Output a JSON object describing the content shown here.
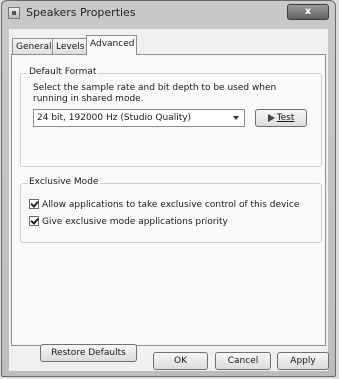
{
  "window": {
    "title": "Speakers Properties",
    "close_label": "x"
  },
  "tabs": [
    {
      "label": "General"
    },
    {
      "label": "Levels"
    },
    {
      "label": "Advanced"
    }
  ],
  "default_format": {
    "label": "Default Format",
    "description": "Select the sample rate and bit depth to be used when running in shared mode.",
    "selected": "24 bit, 192000 Hz (Studio Quality)",
    "test_label": "Test"
  },
  "exclusive_mode": {
    "label": "Exclusive Mode",
    "options": [
      {
        "label": "Allow applications to take exclusive control of this device",
        "checked": true
      },
      {
        "label": "Give exclusive mode applications priority",
        "checked": true
      }
    ]
  },
  "buttons": {
    "restore": "Restore Defaults",
    "ok": "OK",
    "cancel": "Cancel",
    "apply": "Apply"
  }
}
